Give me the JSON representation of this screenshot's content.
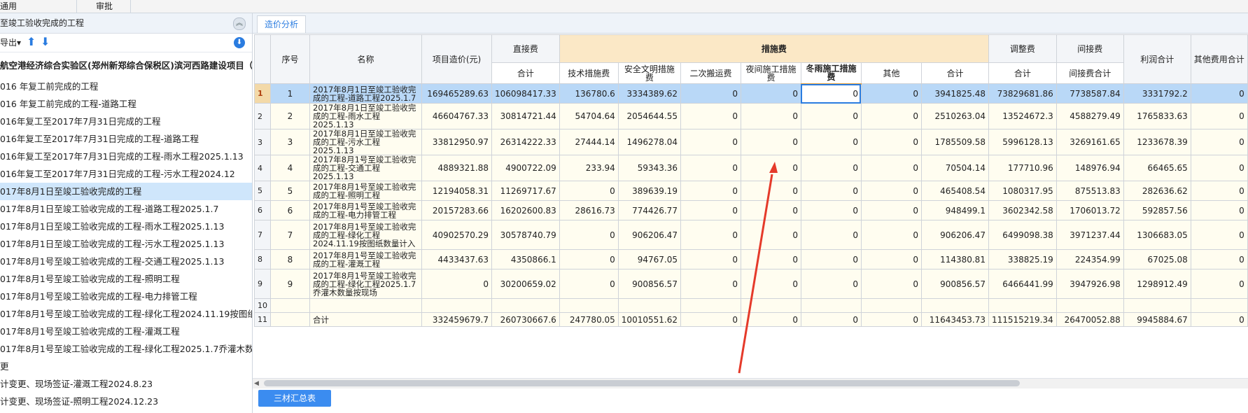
{
  "menu": {
    "item1": "通用",
    "item2": "审批"
  },
  "left": {
    "header_title": "至竣工验收完成的工程",
    "export_label": "导出",
    "tree": [
      {
        "label": "航空港经济综合实验区(郑州新郑综合保税区)滨河西路建设项目（...",
        "root": true
      },
      {
        "label": "016 年复工前完成的工程"
      },
      {
        "label": "016 年复工前完成的工程-道路工程"
      },
      {
        "label": "016年复工至2017年7月31日完成的工程"
      },
      {
        "label": "016年复工至2017年7月31日完成的工程-道路工程"
      },
      {
        "label": "016年复工至2017年7月31日完成的工程-雨水工程2025.1.13"
      },
      {
        "label": "016年复工至2017年7月31日完成的工程-污水工程2024.12"
      },
      {
        "label": "017年8月1日至竣工验收完成的工程",
        "selected": true
      },
      {
        "label": "017年8月1日至竣工验收完成的工程-道路工程2025.1.7"
      },
      {
        "label": "017年8月1日至竣工验收完成的工程-雨水工程2025.1.13"
      },
      {
        "label": "017年8月1日至竣工验收完成的工程-污水工程2025.1.13"
      },
      {
        "label": "017年8月1号至竣工验收完成的工程-交通工程2025.1.13"
      },
      {
        "label": "017年8月1号至竣工验收完成的工程-照明工程"
      },
      {
        "label": "017年8月1号至竣工验收完成的工程-电力排管工程"
      },
      {
        "label": "017年8月1号至竣工验收完成的工程-绿化工程2024.11.19按图纸..."
      },
      {
        "label": "017年8月1号至竣工验收完成的工程-灌溉工程"
      },
      {
        "label": "017年8月1号至竣工验收完成的工程-绿化工程2025.1.7乔灌木数..."
      },
      {
        "label": "更"
      },
      {
        "label": "计变更、现场签证-灌溉工程2024.8.23"
      },
      {
        "label": "计变更、现场签证-照明工程2024.12.23"
      }
    ]
  },
  "tabs": {
    "active": "造价分析"
  },
  "grid": {
    "headers": {
      "seq": "序号",
      "name": "名称",
      "cost": "项目造价(元)",
      "direct": "直接费",
      "direct_sub": "合计",
      "measures": "措施费",
      "m_tech": "技术措施费",
      "m_safe": "安全文明措施费",
      "m_second": "二次搬运费",
      "m_night": "夜间施工措施费",
      "m_winter": "冬雨施工措施费",
      "m_other": "其他",
      "m_total": "合计",
      "adjust": "调整费",
      "adjust_sub": "合计",
      "indirect": "间接费",
      "indirect_sub": "间接费合计",
      "profit": "利润合计",
      "other_total": "其他费用合计"
    },
    "rows": [
      {
        "rn": "1",
        "seq": "1",
        "name": "2017年8月1日至竣工验收完成的工程-道路工程2025.1.7",
        "cost": "169465289.63",
        "direct": "106098417.33",
        "tech": "136780.6",
        "safe": "3334389.62",
        "second": "0",
        "night": "0",
        "winter": "0",
        "other": "0",
        "mtotal": "3941825.48",
        "adjust": "73829681.86",
        "indirect": "7738587.84",
        "profit": "3331792.2",
        "ototal": "0"
      },
      {
        "rn": "2",
        "seq": "2",
        "name": "2017年8月1日至竣工验收完成的工程-雨水工程2025.1.13",
        "cost": "46604767.33",
        "direct": "30814721.44",
        "tech": "54704.64",
        "safe": "2054644.55",
        "second": "0",
        "night": "0",
        "winter": "0",
        "other": "0",
        "mtotal": "2510263.04",
        "adjust": "13524672.3",
        "indirect": "4588279.49",
        "profit": "1765833.63",
        "ototal": "0"
      },
      {
        "rn": "3",
        "seq": "3",
        "name": "2017年8月1日至竣工验收完成的工程-污水工程2025.1.13",
        "cost": "33812950.97",
        "direct": "26314222.33",
        "tech": "27444.14",
        "safe": "1496278.04",
        "second": "0",
        "night": "0",
        "winter": "0",
        "other": "0",
        "mtotal": "1785509.58",
        "adjust": "5996128.13",
        "indirect": "3269161.65",
        "profit": "1233678.39",
        "ototal": "0"
      },
      {
        "rn": "4",
        "seq": "4",
        "name": "2017年8月1号至竣工验收完成的工程-交通工程2025.1.13",
        "cost": "4889321.88",
        "direct": "4900722.09",
        "tech": "233.94",
        "safe": "59343.36",
        "second": "0",
        "night": "0",
        "winter": "0",
        "other": "0",
        "mtotal": "70504.14",
        "adjust": "177710.96",
        "indirect": "148976.94",
        "profit": "66465.65",
        "ototal": "0"
      },
      {
        "rn": "5",
        "seq": "5",
        "name": "2017年8月1号至竣工验收完成的工程-照明工程",
        "cost": "12194058.31",
        "direct": "11269717.67",
        "tech": "0",
        "safe": "389639.19",
        "second": "0",
        "night": "0",
        "winter": "0",
        "other": "0",
        "mtotal": "465408.54",
        "adjust": "1080317.95",
        "indirect": "875513.83",
        "profit": "282636.62",
        "ototal": "0"
      },
      {
        "rn": "6",
        "seq": "6",
        "name": "2017年8月1号至竣工验收完成的工程-电力排管工程",
        "cost": "20157283.66",
        "direct": "16202600.83",
        "tech": "28616.73",
        "safe": "774426.77",
        "second": "0",
        "night": "0",
        "winter": "0",
        "other": "0",
        "mtotal": "948499.1",
        "adjust": "3602342.58",
        "indirect": "1706013.72",
        "profit": "592857.56",
        "ototal": "0"
      },
      {
        "rn": "7",
        "seq": "7",
        "name": "2017年8月1号至竣工验收完成的工程-绿化工程2024.11.19按图纸数量计入",
        "cost": "40902570.29",
        "direct": "30578740.79",
        "tech": "0",
        "safe": "906206.47",
        "second": "0",
        "night": "0",
        "winter": "0",
        "other": "0",
        "mtotal": "906206.47",
        "adjust": "6499098.38",
        "indirect": "3971237.44",
        "profit": "1306683.05",
        "ototal": "0"
      },
      {
        "rn": "8",
        "seq": "8",
        "name": "2017年8月1号至竣工验收完成的工程-灌溉工程",
        "cost": "4433437.63",
        "direct": "4350866.1",
        "tech": "0",
        "safe": "94767.05",
        "second": "0",
        "night": "0",
        "winter": "0",
        "other": "0",
        "mtotal": "114380.81",
        "adjust": "338825.19",
        "indirect": "224354.99",
        "profit": "67025.08",
        "ototal": "0"
      },
      {
        "rn": "9",
        "seq": "9",
        "name": "2017年8月1号至竣工验收完成的工程-绿化工程2025.1.7乔灌木数量按现场",
        "cost": "0",
        "direct": "30200659.02",
        "tech": "0",
        "safe": "900856.57",
        "second": "0",
        "night": "0",
        "winter": "0",
        "other": "0",
        "mtotal": "900856.57",
        "adjust": "6466441.99",
        "indirect": "3947926.98",
        "profit": "1298912.49",
        "ototal": "0"
      },
      {
        "rn": "10",
        "seq": "",
        "name": "",
        "cost": "",
        "direct": "",
        "tech": "",
        "safe": "",
        "second": "",
        "night": "",
        "winter": "",
        "other": "",
        "mtotal": "",
        "adjust": "",
        "indirect": "",
        "profit": "",
        "ototal": ""
      },
      {
        "rn": "11",
        "seq": "",
        "name": "合计",
        "cost": "332459679.7",
        "direct": "260730667.6",
        "tech": "247780.05",
        "safe": "10010551.62",
        "second": "0",
        "night": "0",
        "winter": "0",
        "other": "0",
        "mtotal": "11643453.73",
        "adjust": "111515219.34",
        "indirect": "26470052.88",
        "profit": "9945884.67",
        "ototal": "0"
      }
    ]
  },
  "bottom": {
    "tab": "三材汇总表"
  },
  "colors": {
    "accent": "#2a7ce0",
    "measures_header": "#fbe8c6",
    "selected_row": "#b9d8f7",
    "arrow": "#e53a2a"
  }
}
